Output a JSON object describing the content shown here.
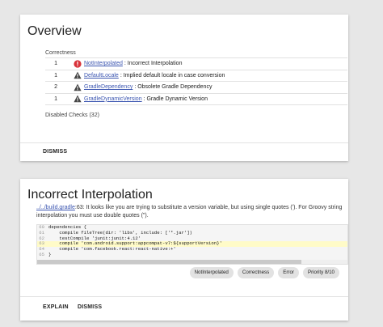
{
  "overview": {
    "title": "Overview",
    "section_label": "Correctness",
    "rows": [
      {
        "count": "1",
        "severity": "error",
        "icon": "error-icon",
        "link": "NotInterpolated",
        "desc": ": Incorrect Interpolation"
      },
      {
        "count": "1",
        "severity": "warning",
        "icon": "warning-icon",
        "link": "DefaultLocale",
        "desc": ": Implied default locale in case conversion"
      },
      {
        "count": "2",
        "severity": "warning",
        "icon": "warning-icon",
        "link": "GradleDependency",
        "desc": ": Obsolete Gradle Dependency"
      },
      {
        "count": "1",
        "severity": "warning",
        "icon": "warning-icon",
        "link": "GradleDynamicVersion",
        "desc": ": Gradle Dynamic Version"
      }
    ],
    "disabled_checks": "Disabled Checks (32)",
    "dismiss_label": "DISMISS"
  },
  "issue": {
    "title": "Incorrect Interpolation",
    "file_link": "../../build.gradle",
    "line_ref": ":63",
    "explanation": ": It looks like you are trying to substitute a version variable, but using single quotes ('). For Groovy string interpolation you must use double quotes (\").",
    "code_lines": [
      {
        "num": "60",
        "text": "dependencies {",
        "highlight": false
      },
      {
        "num": "61",
        "text": "    compile fileTree(dir: 'libs', include: ['*.jar'])",
        "highlight": false
      },
      {
        "num": "62",
        "text": "    testCompile 'junit:junit:4.12'",
        "highlight": false
      },
      {
        "num": "63",
        "text": "    compile 'com.android.support:appcompat-v7:${supportVersion}'",
        "highlight": true
      },
      {
        "num": "64",
        "text": "    compile 'com.facebook.react:react-native:+'",
        "highlight": false
      },
      {
        "num": "65",
        "text": "}",
        "highlight": false
      }
    ],
    "chips": [
      "NotInterpolated",
      "Correctness",
      "Error",
      "Priority 8/10"
    ],
    "explain_label": "EXPLAIN",
    "dismiss_label": "DISMISS"
  },
  "colors": {
    "background": "#e7e7e7",
    "link": "#3b55b0",
    "error_icon": "#d8323a",
    "warning_icon": "#444444",
    "code_highlight": "#fffbc8"
  }
}
